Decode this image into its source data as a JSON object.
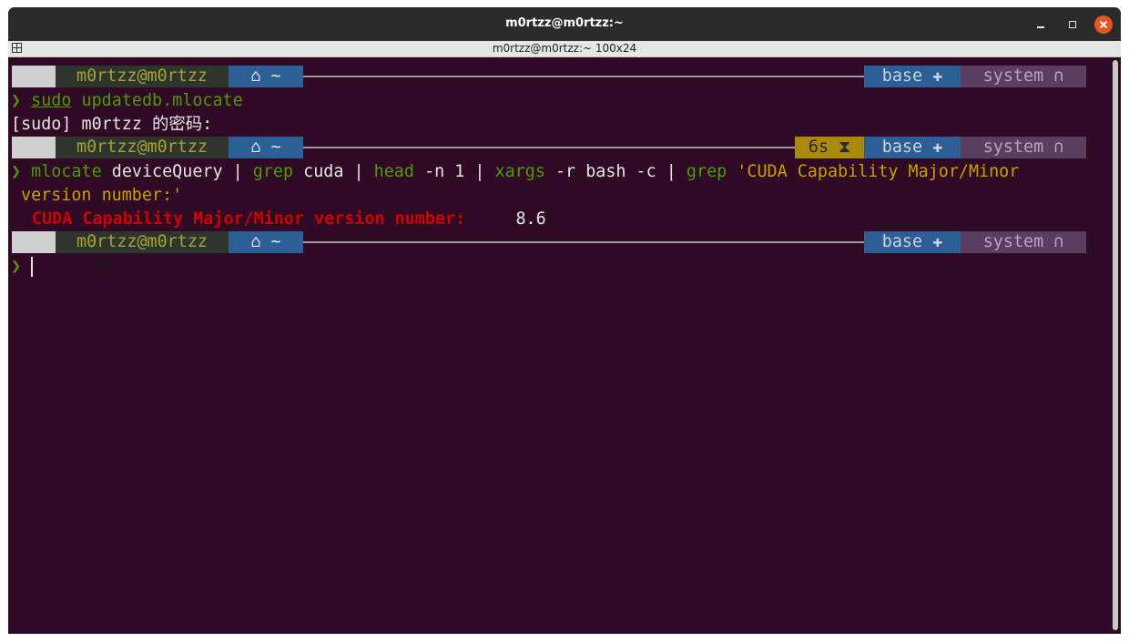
{
  "window": {
    "title": "m0rtzz@m0rtzz:~",
    "tab_title": "m0rtzz@m0rtzz:~ 100x24"
  },
  "prompt": {
    "os_icon": "ubuntu-icon",
    "user_host": "m0rtzz@m0rtzz",
    "home_icon": "home-icon",
    "dir": "~",
    "conda_env": "base",
    "conda_icon": "python-icon",
    "right_label": "system",
    "right_icon": "arch-icon",
    "prompt_char": "❯",
    "timer": "6s",
    "timer_icon": "hourglass-icon"
  },
  "lines": {
    "cmd1_sudo": "sudo",
    "cmd1_rest": "updatedb.mlocate",
    "sudo_prompt": "[sudo] m0rtzz 的密码:",
    "cmd2": [
      {
        "text": "mlocate",
        "style": "green"
      },
      {
        "text": " deviceQuery ",
        "style": "white"
      },
      {
        "text": "|",
        "style": "white"
      },
      {
        "text": " grep",
        "style": "green"
      },
      {
        "text": " cuda ",
        "style": "white"
      },
      {
        "text": "|",
        "style": "white"
      },
      {
        "text": " head",
        "style": "green"
      },
      {
        "text": " -n 1 ",
        "style": "white"
      },
      {
        "text": "|",
        "style": "white"
      },
      {
        "text": " xargs",
        "style": "green"
      },
      {
        "text": " -r bash -c ",
        "style": "white"
      },
      {
        "text": "|",
        "style": "white"
      },
      {
        "text": " grep",
        "style": "green"
      },
      {
        "text": " 'CUDA Capability Major/Minor",
        "style": "olive"
      }
    ],
    "cmd2_wrap": "version number:'",
    "output_label": "CUDA Capability Major/Minor version number:",
    "output_value": "8.6"
  },
  "colors": {
    "terminal_bg": "#300a24",
    "titlebar_bg": "#2b2b2b",
    "close_button": "#e95420",
    "prompt_green": "#4e9a06",
    "string_olive": "#c4a000",
    "match_red": "#cc0000"
  }
}
